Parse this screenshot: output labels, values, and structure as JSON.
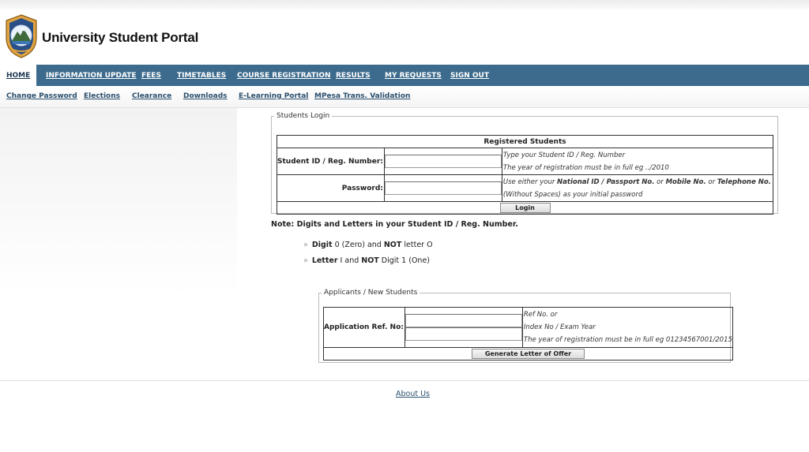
{
  "site": {
    "title": "University Student Portal"
  },
  "nav": [
    {
      "label": "HOME",
      "active": true
    },
    {
      "label": "INFORMATION UPDATE"
    },
    {
      "label": "FEES"
    },
    {
      "label": "TIMETABLES"
    },
    {
      "label": "COURSE REGISTRATION"
    },
    {
      "label": "RESULTS"
    },
    {
      "label": "MY REQUESTS"
    },
    {
      "label": "SIGN OUT"
    }
  ],
  "subnav": [
    "Change Password",
    "Elections",
    "Clearance",
    "Downloads",
    "E-Learning Portal",
    "MPesa Trans. Validation"
  ],
  "login": {
    "legend": "Students Login",
    "header": "Registered Students",
    "id_label": "Student ID / Reg. Number:",
    "id_value": "",
    "id_hint_1": "Type your Student ID / Reg. Number",
    "id_hint_2": "The year of registration must be in full eg ../2010",
    "pw_label": "Password:",
    "pw_value": "",
    "pw_hint_1_a": "Use either your ",
    "pw_hint_1_b": "National ID / Passport No.",
    "pw_hint_1_c": " or ",
    "pw_hint_1_d": "Mobile No.",
    "pw_hint_1_e": " or ",
    "pw_hint_1_f": "Telephone No.",
    "pw_hint_2": "(Without Spaces) as your initial password",
    "button": "Login"
  },
  "note": {
    "title": "Note: Digits and Letters in your Student ID / Reg. Number.",
    "tip1_a": "Digit",
    "tip1_b": " 0 (Zero) and ",
    "tip1_c": "NOT",
    "tip1_d": " letter O",
    "tip2_a": "Letter",
    "tip2_b": " I and ",
    "tip2_c": "NOT",
    "tip2_d": " Digit 1 (One)"
  },
  "applicants": {
    "legend": "Applicants / New Students",
    "label": "Application Ref. No:",
    "value_1": "",
    "value_2": "",
    "hint_1": "Ref No. or",
    "hint_2": "Index No / Exam Year",
    "hint_3": "The year of registration must be in full eg 01234567001/2015",
    "button": "Generate Letter of Offer"
  },
  "footer": {
    "about": "About Us"
  },
  "icons": {
    "logo": "university-crest-icon",
    "bullet": "double-chevron-right-icon"
  },
  "colors": {
    "nav_bg": "#3d6b8d",
    "link": "#2a4f6d"
  }
}
